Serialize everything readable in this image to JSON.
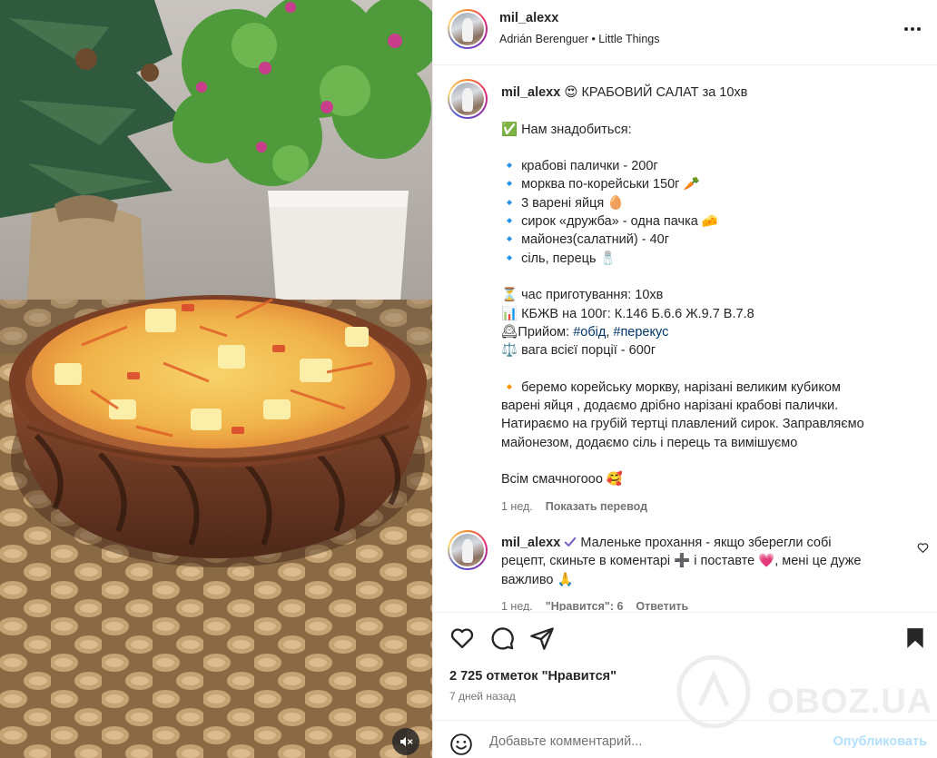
{
  "header": {
    "username": "mil_alexx",
    "subtitle": "Adrián Berenguer • Little Things",
    "more_icon": "more-horizontal-icon"
  },
  "caption": {
    "username": "mil_alexx",
    "lines": [
      "😍 КРАБОВИЙ САЛАТ за 10хв",
      "",
      "✅ Нам знадобиться:",
      "",
      "🔹 крабові палички - 200г",
      "🔹 морква по-корейськи 150г 🥕",
      "🔹 3 варені яйця 🥚",
      "🔹 сирок «дружба» - одна пачка 🧀",
      "🔹 майонез(салатний) - 40г",
      "🔹 сіль, перець 🧂",
      "",
      "⏳ час приготування: 10хв",
      "📊 КБЖВ на 100г: К.146 Б.6.6 Ж.9.7 В.7.8",
      "🕰Прийом: ",
      "⚖️ вага всієї порції - 600г",
      "",
      "🔸 беремо корейську моркву, нарізані великим кубиком",
      "варені яйця , додаємо дрібно нарізані крабові палички.",
      "Натираємо на грубій тертці плавлений сирок. Заправляємо",
      "майонезом, додаємо сіль і перець та вимішуємо",
      "",
      "Всім смачногооо 🥰"
    ],
    "tags": [
      "#обід",
      "#перекус"
    ],
    "tag_separator": ", ",
    "age": "1 нед.",
    "translate": "Показать перевод"
  },
  "comment": {
    "username": "mil_alexx",
    "text_1": "Маленьке прохання - якщо зберегли собі",
    "text_2": "рецепт, скиньте в коментарі ➕ і поставте 💗, мені це дуже",
    "text_3": "важливо 🙏",
    "age": "1 нед.",
    "likes": "\"Нравится\": 6",
    "reply": "Ответить"
  },
  "actions": {
    "likes": "2 725 отметок \"Нравится\"",
    "time": "7 дней назад"
  },
  "add_comment": {
    "placeholder": "Добавьте комментарий...",
    "publish": "Опубликовать"
  },
  "watermark": "OBOZ.UA",
  "colors": {
    "link": "#00376b",
    "publish": "#b2dffc",
    "meta": "#737373"
  }
}
